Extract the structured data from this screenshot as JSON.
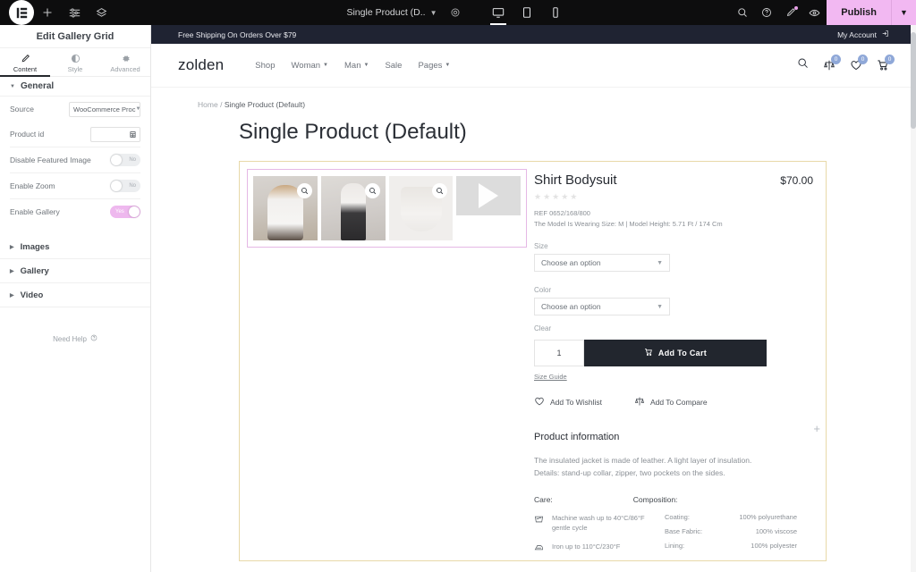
{
  "topbar": {
    "logo_icon": "elementor-logo-icon",
    "add_icon": "plus-icon",
    "settings_icon": "sliders-icon",
    "layers_icon": "layers-icon",
    "document_title": "Single Product (D..",
    "document_chevron": "chevron-down-icon",
    "document_settings_icon": "gear-icon",
    "devices": [
      {
        "name": "desktop",
        "icon": "desktop-icon",
        "active": true
      },
      {
        "name": "tablet",
        "icon": "tablet-icon",
        "active": false
      },
      {
        "name": "mobile",
        "icon": "mobile-icon",
        "active": false
      }
    ],
    "right_icons": [
      {
        "name": "site-search",
        "icon": "search-icon"
      },
      {
        "name": "help",
        "icon": "question-circle-icon"
      },
      {
        "name": "history",
        "icon": "pen-icon",
        "badge": true
      },
      {
        "name": "preview",
        "icon": "eye-icon"
      }
    ],
    "publish_label": "Publish",
    "publish_chevron": "chevron-down-icon",
    "publish_color": "#f2b8f2"
  },
  "panel": {
    "title": "Edit Gallery Grid",
    "tabs": [
      {
        "label": "Content",
        "icon": "pencil-icon",
        "active": true
      },
      {
        "label": "Style",
        "icon": "contrast-circle-icon",
        "active": false
      },
      {
        "label": "Advanced",
        "icon": "gear-icon",
        "active": false
      }
    ],
    "section_general": "General",
    "controls": {
      "source_label": "Source",
      "source_value": "WooCommerce Proc",
      "product_id_label": "Product id",
      "product_id_value": "",
      "product_id_icon": "database-icon",
      "disable_featured_label": "Disable Featured Image",
      "disable_featured_value": "No",
      "enable_zoom_label": "Enable Zoom",
      "enable_zoom_value": "No",
      "enable_gallery_label": "Enable Gallery",
      "enable_gallery_value": "Yes"
    },
    "accordions": [
      {
        "label": "Images"
      },
      {
        "label": "Gallery"
      },
      {
        "label": "Video"
      }
    ],
    "need_help": "Need Help",
    "need_help_icon": "question-circle-icon",
    "collapse_icon": "chevron-left-icon"
  },
  "preview": {
    "announcement": "Free Shipping On Orders Over $79",
    "my_account": "My Account",
    "my_account_icon": "login-icon",
    "brand": "zolden",
    "nav": [
      {
        "label": "Shop",
        "has_caret": false
      },
      {
        "label": "Woman",
        "has_caret": true
      },
      {
        "label": "Man",
        "has_caret": true
      },
      {
        "label": "Sale",
        "has_caret": false
      },
      {
        "label": "Pages",
        "has_caret": true
      }
    ],
    "header_icons": [
      {
        "name": "search-icon",
        "count": null
      },
      {
        "name": "compare-icon",
        "count": "0"
      },
      {
        "name": "wishlist-heart-icon",
        "count": "0"
      },
      {
        "name": "cart-icon",
        "count": "0"
      }
    ],
    "breadcrumb_home": "Home",
    "breadcrumb_sep": "/",
    "breadcrumb_current": "Single Product (Default)",
    "page_title": "Single Product (Default)",
    "gallery": {
      "thumbs": [
        {
          "name": "gallery-thumb-1",
          "zoom_icon": "magnifier-icon",
          "video": false
        },
        {
          "name": "gallery-thumb-2",
          "zoom_icon": "magnifier-icon",
          "video": false
        },
        {
          "name": "gallery-thumb-3",
          "zoom_icon": "magnifier-icon",
          "video": false
        },
        {
          "name": "gallery-thumb-4",
          "zoom_icon": "play-icon",
          "video": true
        }
      ]
    },
    "product": {
      "name": "Shirt Bodysuit",
      "price": "$70.00",
      "stars": "★★★★★",
      "ref": "REF 0652/168/800",
      "model_info": "The Model Is Wearing Size: M | Model Height: 5.71 Ft / 174 Cm",
      "size_label": "Size",
      "size_value": "Choose an option",
      "color_label": "Color",
      "color_value": "Choose an option",
      "clear_label": "Clear",
      "qty_value": "1",
      "add_to_cart": "Add To Cart",
      "cart_icon": "cart-icon",
      "size_guide": "Size Guide",
      "wishlist_label": "Add To Wishlist",
      "wishlist_icon": "heart-icon",
      "compare_label": "Add To Compare",
      "compare_icon": "scales-icon",
      "info_title": "Product information",
      "info_line1": "The insulated jacket is made of leather. A light layer of insulation.",
      "info_line2": "Details: stand-up collar, zipper, two pockets on the sides.",
      "care_heading": "Care:",
      "composition_heading": "Composition:",
      "care_items": [
        {
          "icon": "wash-icon",
          "text": "Machine wash up to 40°C/86°F gentle cycle"
        },
        {
          "icon": "iron-icon",
          "text": "Iron up to 110°C/230°F"
        }
      ],
      "composition_items": [
        {
          "label": "Coating:",
          "value": "100% polyurethane"
        },
        {
          "label": "Base Fabric:",
          "value": "100% viscose"
        },
        {
          "label": "Lining:",
          "value": "100% polyester"
        }
      ]
    },
    "add_widget_icon": "plus-icon"
  }
}
